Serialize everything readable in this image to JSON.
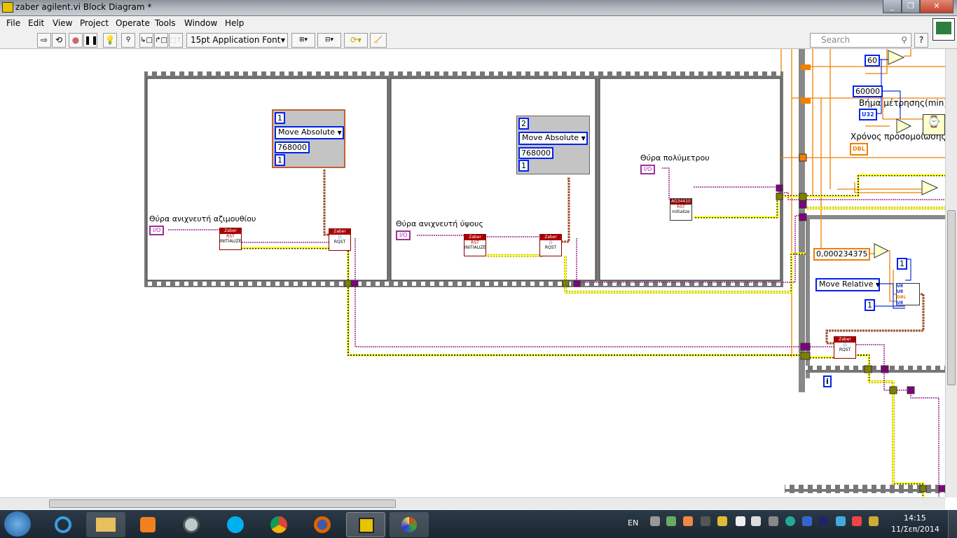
{
  "window": {
    "title": "zaber agilent.vi Block Diagram *",
    "controls": [
      "minimize",
      "restore",
      "close"
    ]
  },
  "menu": [
    "File",
    "Edit",
    "View",
    "Project",
    "Operate",
    "Tools",
    "Window",
    "Help"
  ],
  "toolbar": {
    "buttons": [
      "run-arrow",
      "run-continuously",
      "abort",
      "pause",
      "highlight-execution",
      "retain-wire-values",
      "step-into",
      "step-over",
      "step-out"
    ],
    "font": "15pt Application Font",
    "search_placeholder": "Search",
    "help": "?"
  },
  "frames": {
    "frame1": {
      "port_label": "Θύρα  ανιχνευτή αζιμουθίου",
      "io": "I/O",
      "cluster": [
        "1",
        "Move Absolute",
        "768000",
        "1"
      ],
      "init": "INITIALIZE",
      "zaber": "Zaber",
      "rqst": "RQST"
    },
    "frame2": {
      "port_label": "Θύρα  ανιχνευτή ύψους",
      "io": "I/O",
      "cluster": [
        "2",
        "Move Absolute",
        "768000",
        "1"
      ],
      "init": "INITIALIZE",
      "zaber": "Zaber",
      "rqst": "RQST"
    },
    "frame3": {
      "port_label": "Θύρα πολύμετρου",
      "io": "I/O",
      "agilent": "AG34410",
      "init": "Initialize"
    }
  },
  "right": {
    "const60": "60",
    "const60000": "60000",
    "step_label": "Βήμα μέτρησης(min)",
    "u32": "U32",
    "sim_label": "Χρόνος προσομοίωσης(",
    "dbl": "DBL",
    "const_small": "0,000234375",
    "ring": "Move Relative",
    "const1a": "1",
    "const1b": "1",
    "bundle": [
      "U8",
      "U8",
      "DBL",
      "U8"
    ],
    "loop_i": "i",
    "zaber": "Zaber",
    "rqst": "RQST"
  },
  "taskbar": {
    "lang": "EN",
    "time": "14:15",
    "date": "11/Σεπ/2014",
    "apps": [
      "internet-explorer",
      "file-explorer",
      "media-player",
      "app-circle",
      "skype",
      "chrome",
      "firefox",
      "labview",
      "paint"
    ]
  }
}
